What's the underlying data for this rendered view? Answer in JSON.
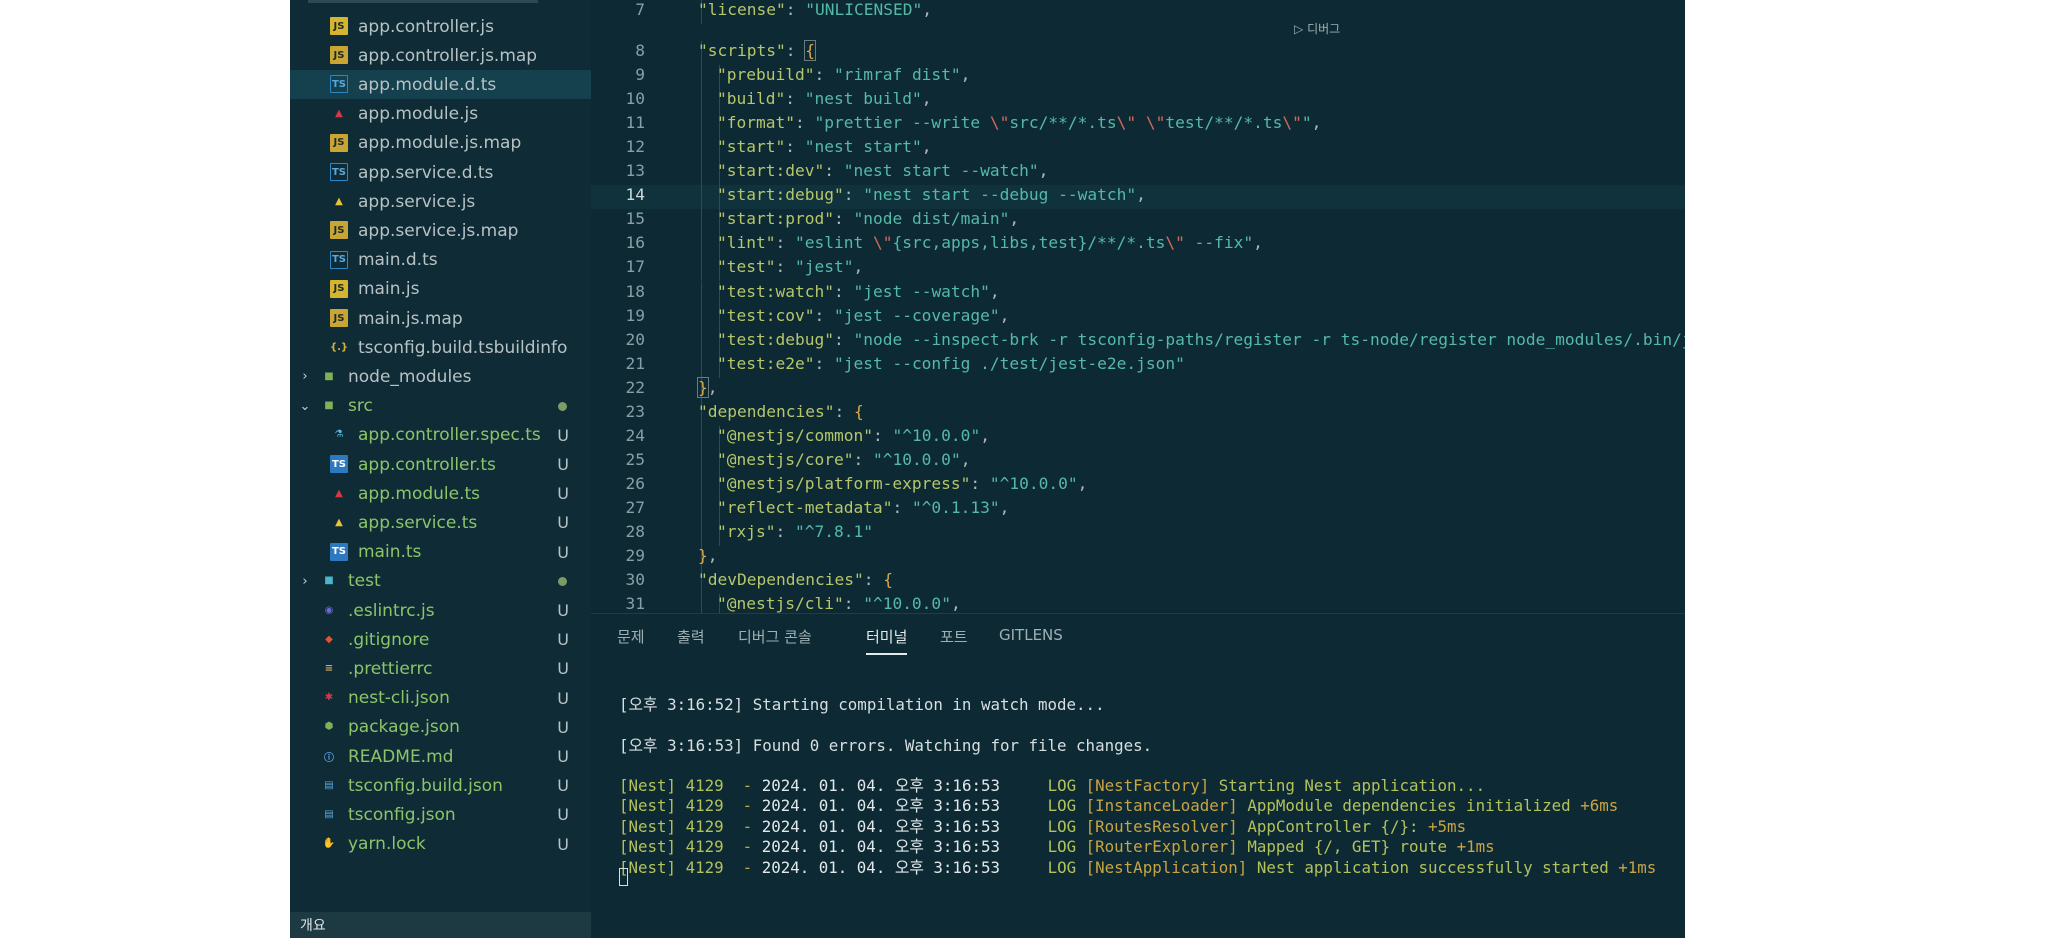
{
  "explorer": {
    "items": [
      {
        "name": "app.controller.js",
        "icon": "js-icon",
        "indent": 2,
        "status": ""
      },
      {
        "name": "app.controller.js.map",
        "icon": "map-icon",
        "indent": 2,
        "status": ""
      },
      {
        "name": "app.module.d.ts",
        "icon": "ts-icon",
        "indent": 2,
        "status": "",
        "selected": true
      },
      {
        "name": "app.module.js",
        "icon": "angular-red-icon",
        "indent": 2,
        "status": ""
      },
      {
        "name": "app.module.js.map",
        "icon": "map-icon",
        "indent": 2,
        "status": ""
      },
      {
        "name": "app.service.d.ts",
        "icon": "ts-icon",
        "indent": 2,
        "status": ""
      },
      {
        "name": "app.service.js",
        "icon": "angular-yellow-icon",
        "indent": 2,
        "status": ""
      },
      {
        "name": "app.service.js.map",
        "icon": "map-icon",
        "indent": 2,
        "status": ""
      },
      {
        "name": "main.d.ts",
        "icon": "ts-icon",
        "indent": 2,
        "status": ""
      },
      {
        "name": "main.js",
        "icon": "js-icon",
        "indent": 2,
        "status": ""
      },
      {
        "name": "main.js.map",
        "icon": "map-icon",
        "indent": 2,
        "status": ""
      },
      {
        "name": "tsconfig.build.tsbuildinfo",
        "icon": "braces-icon",
        "indent": 2,
        "status": ""
      },
      {
        "name": "node_modules",
        "icon": "folder-green-icon",
        "indent": 1,
        "status": "",
        "folder": true
      },
      {
        "name": "src",
        "icon": "folder-green-icon",
        "indent": 1,
        "status": "dot",
        "folder": true,
        "open": true,
        "untracked": true
      },
      {
        "name": "app.controller.spec.ts",
        "icon": "test-icon",
        "indent": 2,
        "status": "U",
        "untracked": true
      },
      {
        "name": "app.controller.ts",
        "icon": "ts-fill-icon",
        "indent": 2,
        "status": "U",
        "untracked": true
      },
      {
        "name": "app.module.ts",
        "icon": "angular-red-icon",
        "indent": 2,
        "status": "U",
        "untracked": true
      },
      {
        "name": "app.service.ts",
        "icon": "angular-yellow-icon",
        "indent": 2,
        "status": "U",
        "untracked": true
      },
      {
        "name": "main.ts",
        "icon": "ts-fill-icon",
        "indent": 2,
        "status": "U",
        "untracked": true
      },
      {
        "name": "test",
        "icon": "folder-blue-icon",
        "indent": 1,
        "status": "dot",
        "folder": true,
        "untracked": true
      },
      {
        "name": ".eslintrc.js",
        "icon": "eslint-icon",
        "indent": 1,
        "status": "U",
        "untracked": true
      },
      {
        "name": ".gitignore",
        "icon": "git-icon",
        "indent": 1,
        "status": "U",
        "untracked": true
      },
      {
        "name": ".prettierrc",
        "icon": "prettier-icon",
        "indent": 1,
        "status": "U",
        "untracked": true
      },
      {
        "name": "nest-cli.json",
        "icon": "nest-icon",
        "indent": 1,
        "status": "U",
        "untracked": true
      },
      {
        "name": "package.json",
        "icon": "node-icon",
        "indent": 1,
        "status": "U",
        "untracked": true
      },
      {
        "name": "README.md",
        "icon": "info-icon",
        "indent": 1,
        "status": "U",
        "untracked": true
      },
      {
        "name": "tsconfig.build.json",
        "icon": "tsconfig-icon",
        "indent": 1,
        "status": "U",
        "untracked": true
      },
      {
        "name": "tsconfig.json",
        "icon": "tsconfig-icon",
        "indent": 1,
        "status": "U",
        "untracked": true
      },
      {
        "name": "yarn.lock",
        "icon": "yarn-icon",
        "indent": 1,
        "status": "U",
        "untracked": true
      }
    ],
    "outline_label": "개요"
  },
  "editor": {
    "codelens": "디버그",
    "lines": [
      {
        "n": "7",
        "level": 1,
        "key": "license",
        "val": "UNLICENSED",
        "tail": ","
      },
      {
        "n": "8",
        "level": 1,
        "key": "scripts",
        "open": "{"
      },
      {
        "n": "9",
        "level": 2,
        "key": "prebuild",
        "val": "rimraf dist",
        "tail": ","
      },
      {
        "n": "10",
        "level": 2,
        "key": "build",
        "val": "nest build",
        "tail": ","
      },
      {
        "n": "11",
        "level": 2,
        "key": "format",
        "raw": "prettier --write \\\"src/**/*.ts\\\" \\\"test/**/*.ts\\\"",
        "tail": ","
      },
      {
        "n": "12",
        "level": 2,
        "key": "start",
        "val": "nest start",
        "tail": ","
      },
      {
        "n": "13",
        "level": 2,
        "key": "start:dev",
        "val": "nest start --watch",
        "tail": ","
      },
      {
        "n": "14",
        "level": 2,
        "key": "start:debug",
        "val": "nest start --debug --watch",
        "tail": ",",
        "active": true
      },
      {
        "n": "15",
        "level": 2,
        "key": "start:prod",
        "val": "node dist/main",
        "tail": ","
      },
      {
        "n": "16",
        "level": 2,
        "key": "lint",
        "raw": "eslint \\\"{src,apps,libs,test}/**/*.ts\\\" --fix",
        "tail": ","
      },
      {
        "n": "17",
        "level": 2,
        "key": "test",
        "val": "jest",
        "tail": ","
      },
      {
        "n": "18",
        "level": 2,
        "key": "test:watch",
        "val": "jest --watch",
        "tail": ","
      },
      {
        "n": "19",
        "level": 2,
        "key": "test:cov",
        "val": "jest --coverage",
        "tail": ","
      },
      {
        "n": "20",
        "level": 2,
        "key": "test:debug",
        "val": "node --inspect-brk -r tsconfig-paths/register -r ts-node/register node_modules/.bin/jest --runInBand",
        "tail": ","
      },
      {
        "n": "21",
        "level": 2,
        "key": "test:e2e",
        "val": "jest --config ./test/jest-e2e.json",
        "tail": ""
      },
      {
        "n": "22",
        "level": 1,
        "close": "}",
        "tail": ","
      },
      {
        "n": "23",
        "level": 1,
        "key": "dependencies",
        "open": "{"
      },
      {
        "n": "24",
        "level": 2,
        "key": "@nestjs/common",
        "val": "^10.0.0",
        "tail": ","
      },
      {
        "n": "25",
        "level": 2,
        "key": "@nestjs/core",
        "val": "^10.0.0",
        "tail": ","
      },
      {
        "n": "26",
        "level": 2,
        "key": "@nestjs/platform-express",
        "val": "^10.0.0",
        "tail": ","
      },
      {
        "n": "27",
        "level": 2,
        "key": "reflect-metadata",
        "val": "^0.1.13",
        "tail": ","
      },
      {
        "n": "28",
        "level": 2,
        "key": "rxjs",
        "val": "^7.8.1",
        "tail": ""
      },
      {
        "n": "29",
        "level": 1,
        "close": "}",
        "tail": ","
      },
      {
        "n": "30",
        "level": 1,
        "key": "devDependencies",
        "open": "{"
      },
      {
        "n": "31",
        "level": 2,
        "key": "@nestjs/cli",
        "val": "^10.0.0",
        "tail": ","
      }
    ]
  },
  "panel": {
    "tabs": [
      {
        "label": "문제",
        "active": false
      },
      {
        "label": "출력",
        "active": false
      },
      {
        "label": "디버그 콘솔",
        "active": false
      },
      {
        "label": "터미널",
        "active": true
      },
      {
        "label": "포트",
        "active": false
      },
      {
        "label": "GITLENS",
        "active": false
      }
    ],
    "terminal": {
      "plain": [
        {
          "time": "[오후 3:16:52]",
          "msg": "Starting compilation in watch mode..."
        },
        {
          "time": "[오후 3:16:53]",
          "msg": "Found 0 errors. Watching for file changes."
        }
      ],
      "logs": [
        {
          "tag": "[Nest]",
          "pid": "4129",
          "date": "2024. 01. 04. 오후 3:16:53",
          "level": "LOG",
          "ctx": "[NestFactory]",
          "msg": "Starting Nest application..."
        },
        {
          "tag": "[Nest]",
          "pid": "4129",
          "date": "2024. 01. 04. 오후 3:16:53",
          "level": "LOG",
          "ctx": "[InstanceLoader]",
          "msg": "AppModule dependencies initialized",
          "extra": "+6ms"
        },
        {
          "tag": "[Nest]",
          "pid": "4129",
          "date": "2024. 01. 04. 오후 3:16:53",
          "level": "LOG",
          "ctx": "[RoutesResolver]",
          "msg": "AppController {/}:",
          "extra": "+5ms"
        },
        {
          "tag": "[Nest]",
          "pid": "4129",
          "date": "2024. 01. 04. 오후 3:16:53",
          "level": "LOG",
          "ctx": "[RouterExplorer]",
          "msg": "Mapped {/, GET} route",
          "extra": "+1ms"
        },
        {
          "tag": "[Nest]",
          "pid": "4129",
          "date": "2024. 01. 04. 오후 3:16:53",
          "level": "LOG",
          "ctx": "[NestApplication]",
          "msg": "Nest application successfully started",
          "extra": "+1ms"
        }
      ]
    }
  }
}
